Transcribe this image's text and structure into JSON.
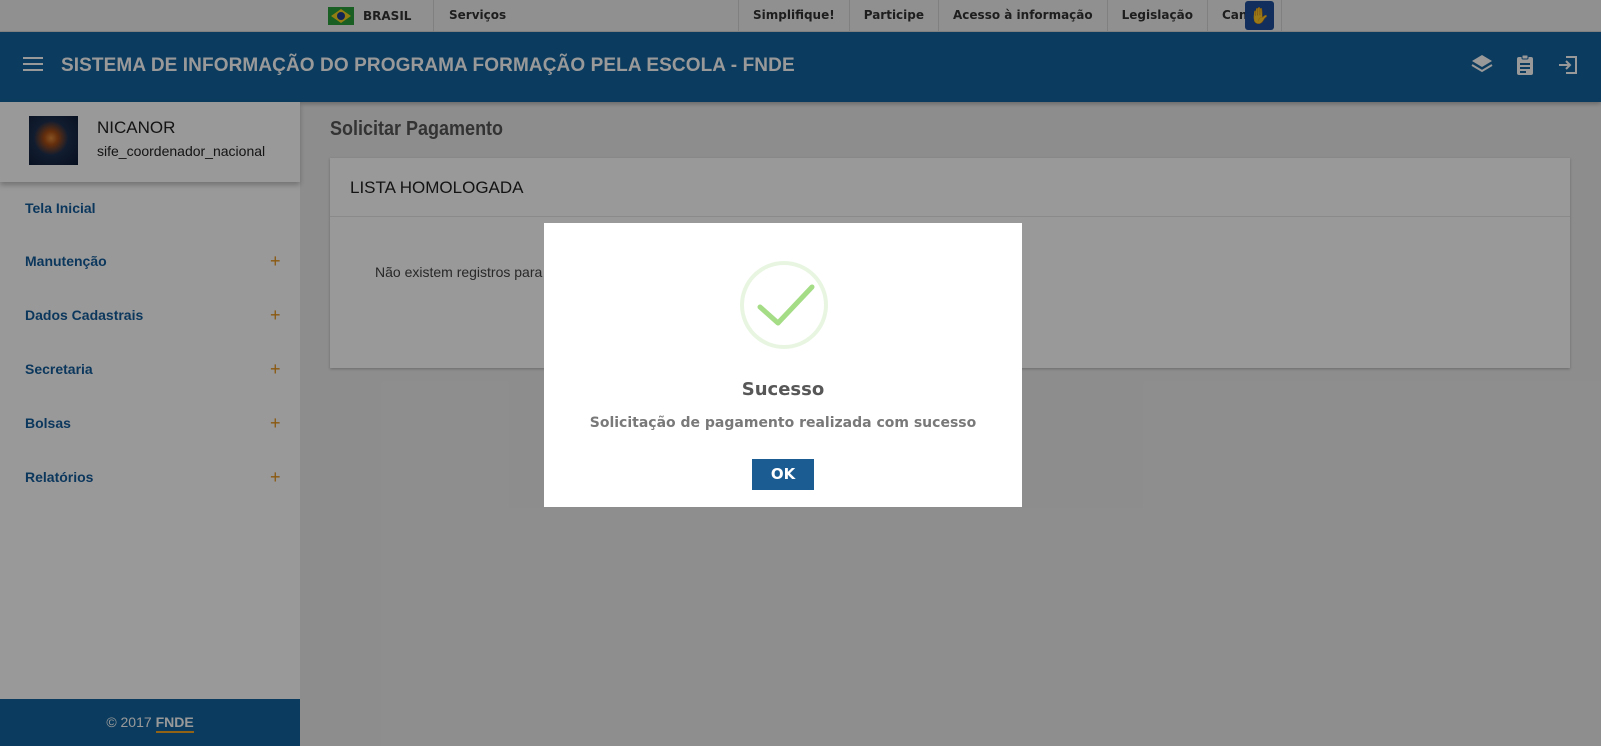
{
  "govbar": {
    "brasil": "BRASIL",
    "servicos": "Serviços",
    "links": [
      "Simplifique!",
      "Participe",
      "Acesso à informação",
      "Legislação",
      "Canais"
    ]
  },
  "header": {
    "title": "SISTEMA DE INFORMAÇÃO DO PROGRAMA FORMAÇÃO PELA ESCOLA - FNDE",
    "icons": [
      "layers-icon",
      "clipboard-icon",
      "logout-icon"
    ]
  },
  "profile": {
    "name": "NICANOR",
    "role": "sife_coordenador_nacional"
  },
  "sidebar": {
    "items": [
      {
        "label": "Tela Inicial",
        "expandable": false
      },
      {
        "label": "Manutenção",
        "expandable": true
      },
      {
        "label": "Dados Cadastrais",
        "expandable": true
      },
      {
        "label": "Secretaria",
        "expandable": true
      },
      {
        "label": "Bolsas",
        "expandable": true
      },
      {
        "label": "Relatórios",
        "expandable": true
      }
    ],
    "plus": "+",
    "footer_copy": "© 2017",
    "footer_brand": "FNDE"
  },
  "main": {
    "page_title": "Solicitar Pagamento",
    "card_title": "LISTA HOMOLOGADA",
    "empty_text": "Não existem registros para"
  },
  "modal": {
    "title": "Sucesso",
    "message": "Solicitação de pagamento realizada com sucesso",
    "ok_label": "OK"
  },
  "colors": {
    "header": "#13649e",
    "accent": "#e8941a",
    "success": "#a5dc86",
    "ok_button": "#1b5c93"
  }
}
